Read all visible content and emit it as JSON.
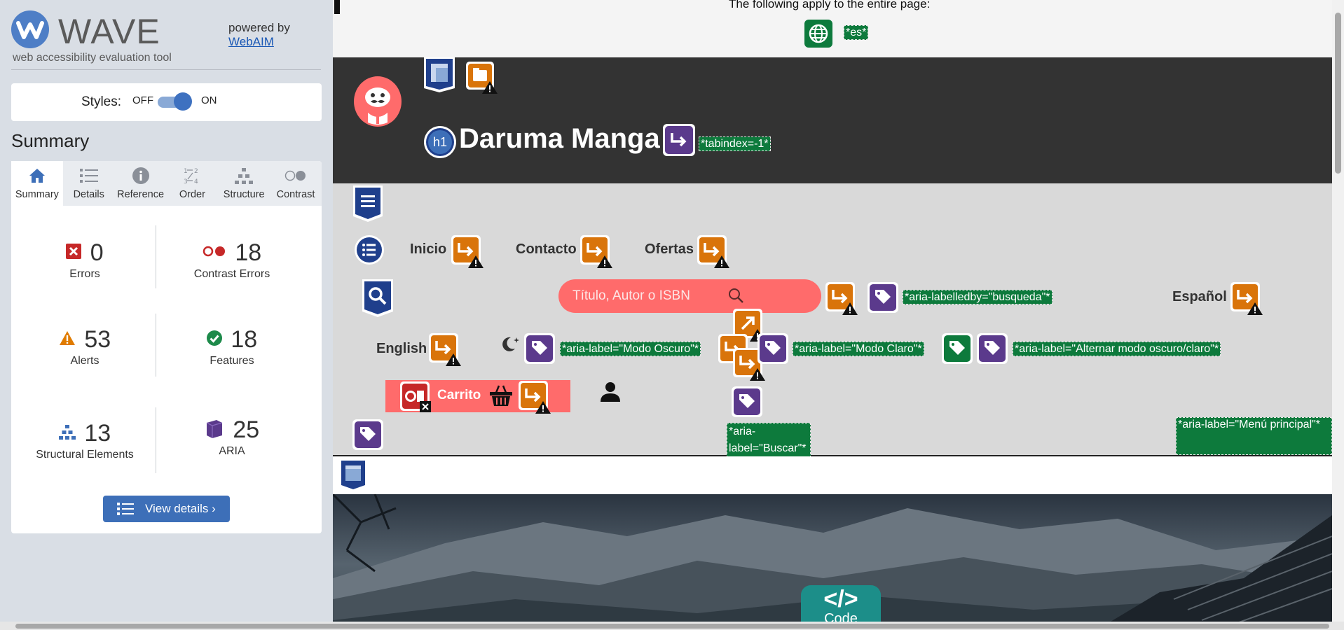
{
  "wave": {
    "logo_word": "WAVE",
    "tagline": "web accessibility evaluation tool",
    "powered_by": "powered by",
    "webaim_link": "WebAIM",
    "styles_label": "Styles:",
    "styles_off": "OFF",
    "styles_on": "ON",
    "summary_heading": "Summary",
    "tabs": [
      {
        "label": "Summary",
        "icon": "home-icon",
        "active": true
      },
      {
        "label": "Details",
        "icon": "list-icon"
      },
      {
        "label": "Reference",
        "icon": "info-icon"
      },
      {
        "label": "Order",
        "icon": "order-icon"
      },
      {
        "label": "Structure",
        "icon": "structure-icon"
      },
      {
        "label": "Contrast",
        "icon": "contrast-icon"
      }
    ],
    "stats": {
      "errors": {
        "count": "0",
        "label": "Errors"
      },
      "contrast_errors": {
        "count": "18",
        "label": "Contrast Errors"
      },
      "alerts": {
        "count": "53",
        "label": "Alerts"
      },
      "features": {
        "count": "18",
        "label": "Features"
      },
      "structural": {
        "count": "13",
        "label": "Structural Elements"
      },
      "aria": {
        "count": "25",
        "label": "ARIA"
      }
    },
    "view_details": "View details ›"
  },
  "page": {
    "apply_text": "The following apply to the entire page:",
    "lang_tag": "*es*",
    "h1_badge": "h1",
    "site_title": "Daruma Manga",
    "tabindex_tag": "*tabindex=-1*",
    "nav": {
      "inicio": "Inicio",
      "contacto": "Contacto",
      "ofertas": "Ofertas"
    },
    "search_placeholder": "Título, Autor o ISBN",
    "labelledby_tag": "*aria-labelledby=\"busqueda\"*",
    "espanol": "Español",
    "english": "English",
    "modo_oscuro_tag": "*aria-label=\"Modo Oscuro\"*",
    "modo_claro_tag": "*aria-label=\"Modo Claro\"*",
    "alternar_tag": "*aria-label=\"Alternar modo oscuro/claro\"*",
    "cart_label": "Carrito",
    "buscar_tag": "*aria-label=\"Buscar\"*",
    "menu_tag": "*aria-label=\"Menú principal\"*",
    "code_symbol": "</>",
    "code_label": "Code"
  },
  "colors": {
    "wave_blue": "#3d6fb8",
    "error_red": "#c62828",
    "alert_orange": "#e07b00",
    "feature_green": "#0d7a3c",
    "aria_purple": "#5b3a8c",
    "structure_navy": "#1f3f8c",
    "accent_coral": "#ff6b6b"
  }
}
